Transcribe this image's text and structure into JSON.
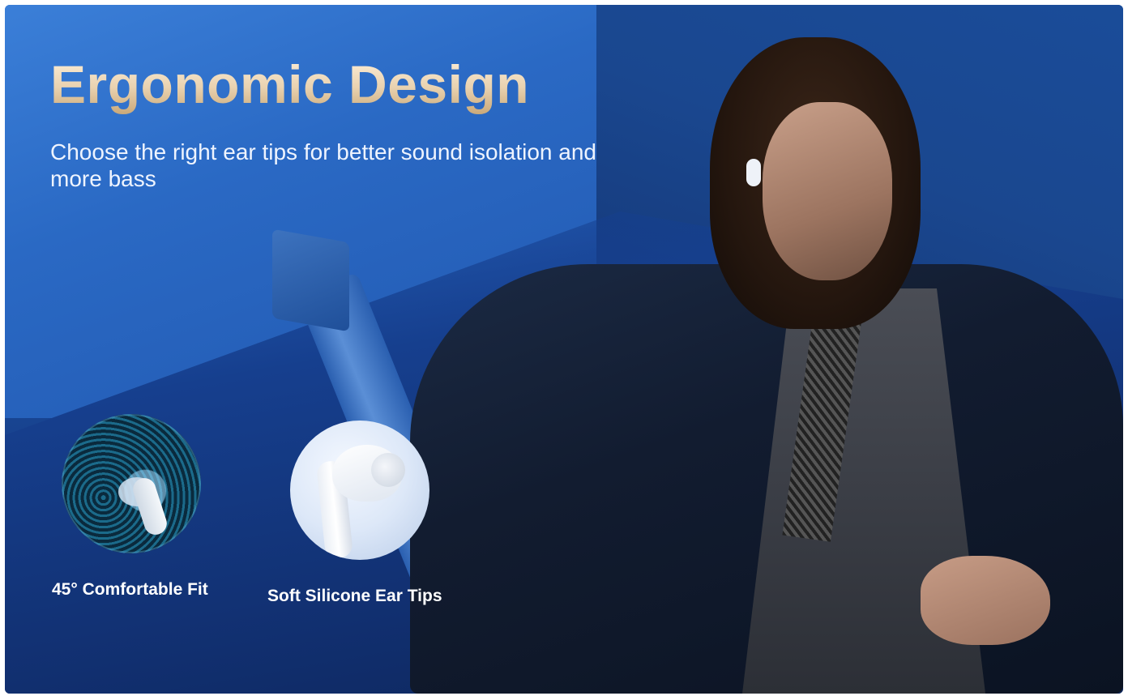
{
  "hero": {
    "headline": "Ergonomic Design",
    "subheadline": "Choose the right ear tips for better sound isolation and more bass"
  },
  "features": [
    {
      "label": "45° Comfortable Fit",
      "icon": "ear-fit-icon"
    },
    {
      "label": "Soft Silicone Ear Tips",
      "icon": "earbud-icon"
    }
  ],
  "colors": {
    "background_blue": "#1f5db8",
    "headline_gold": "#e9d2b0",
    "text_white": "#ffffff"
  }
}
